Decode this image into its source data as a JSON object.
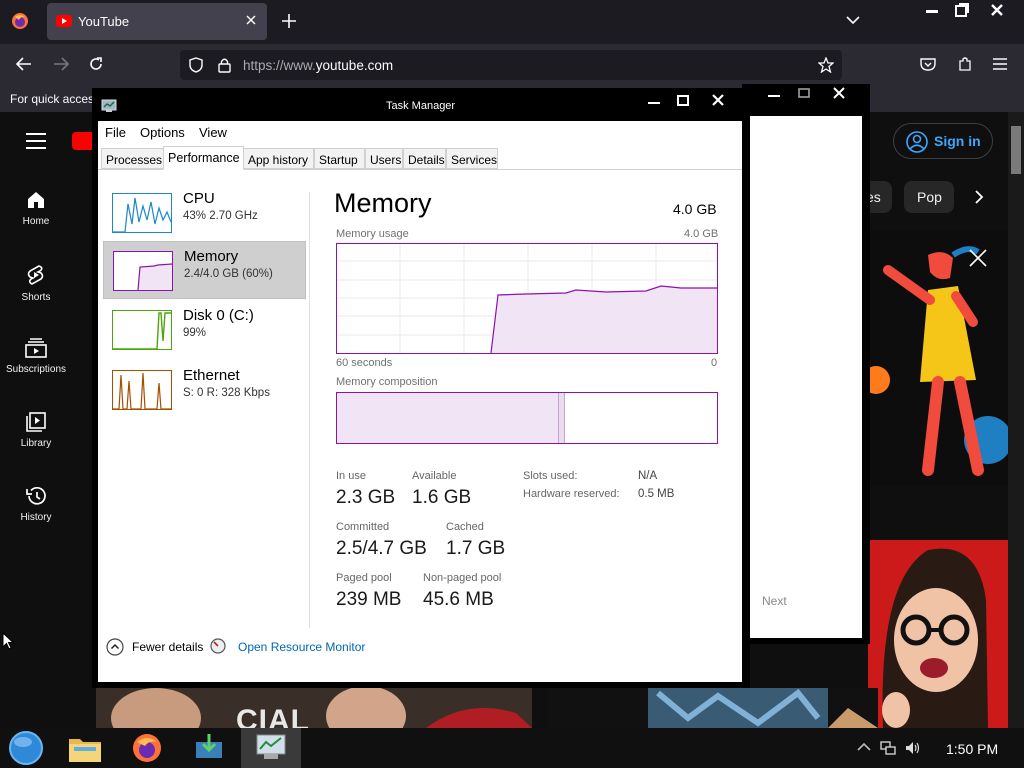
{
  "browser": {
    "tab_title": "YouTube",
    "url_prefix": "https://www.",
    "url_domain": "youtube.com",
    "bookmarks_text": "For quick acces"
  },
  "youtube": {
    "nav": [
      {
        "label": "Home",
        "icon": "home-icon"
      },
      {
        "label": "Shorts",
        "icon": "shorts-icon"
      },
      {
        "label": "Subscriptions",
        "icon": "subscriptions-icon"
      },
      {
        "label": "Library",
        "icon": "library-icon"
      },
      {
        "label": "History",
        "icon": "history-icon"
      }
    ],
    "sign_in": "Sign in",
    "chip_partial": "es",
    "chip_pop": "Pop",
    "thumb_text": "CIAL"
  },
  "second_window": {
    "next": "Next"
  },
  "task_manager": {
    "title": "Task Manager",
    "menu": [
      "File",
      "Options",
      "View"
    ],
    "tabs": [
      "Processes",
      "Performance",
      "App history",
      "Startup",
      "Users",
      "Details",
      "Services"
    ],
    "active_tab": "Performance",
    "sidebar": [
      {
        "name": "CPU",
        "sub": "43%  2.70 GHz",
        "color": "#1a88c9"
      },
      {
        "name": "Memory",
        "sub": "2.4/4.0 GB (60%)",
        "color": "#8b12ae"
      },
      {
        "name": "Disk 0 (C:)",
        "sub": "99%",
        "color": "#4da60c"
      },
      {
        "name": "Ethernet",
        "sub": "S: 0 R: 328 Kbps",
        "color": "#a74f01"
      }
    ],
    "main": {
      "heading": "Memory",
      "capacity": "4.0 GB",
      "usage_label": "Memory usage",
      "usage_max": "4.0 GB",
      "x_left": "60 seconds",
      "x_right": "0",
      "composition_label": "Memory composition",
      "in_use_fraction": 0.6
    },
    "stats": {
      "in_use_label": "In use",
      "in_use": "2.3 GB",
      "available_label": "Available",
      "available": "1.6 GB",
      "committed_label": "Committed",
      "committed": "2.5/4.7 GB",
      "cached_label": "Cached",
      "cached": "1.7 GB",
      "paged_label": "Paged pool",
      "paged": "239 MB",
      "nonpaged_label": "Non-paged pool",
      "nonpaged": "45.6 MB",
      "slots_label": "Slots used:",
      "slots": "N/A",
      "hw_label": "Hardware reserved:",
      "hw": "0.5 MB"
    },
    "footer": {
      "fewer": "Fewer details",
      "resource": "Open Resource Monitor"
    }
  },
  "taskbar": {
    "clock": "1:50 PM"
  },
  "colors": {
    "memory_accent": "#8b12ae",
    "link": "#0066b4",
    "youtube_red": "#ff0000"
  }
}
